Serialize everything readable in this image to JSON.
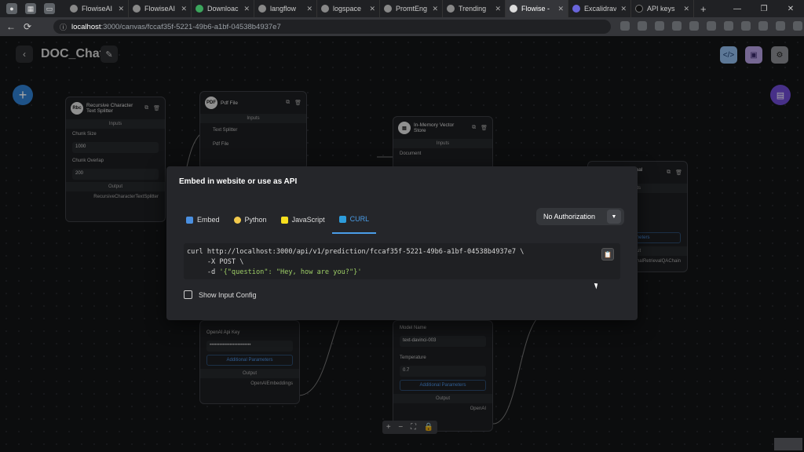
{
  "browser": {
    "tabs": [
      {
        "title": "FlowiseAI",
        "active": false
      },
      {
        "title": "FlowiseAI",
        "active": false
      },
      {
        "title": "Downloac",
        "active": false
      },
      {
        "title": "langflow",
        "active": false
      },
      {
        "title": "logspace",
        "active": false
      },
      {
        "title": "PromtEng",
        "active": false
      },
      {
        "title": "Trending",
        "active": false
      },
      {
        "title": "Flowise -",
        "active": true
      },
      {
        "title": "Excalidrav",
        "active": false
      },
      {
        "title": "API keys",
        "active": false
      }
    ],
    "url_host": "localhost",
    "url_path": ":3000/canvas/fccaf35f-5221-49b6-a1bf-04538b4937e7"
  },
  "canvas": {
    "title": "DOC_Chat",
    "nodes": {
      "splitter": {
        "title1": "Recursive Character",
        "title2": "Text Splitter",
        "inputs": "Inputs",
        "chunk_size_label": "Chunk Size",
        "chunk_size": "1000",
        "chunk_overlap_label": "Chunk Overlap",
        "chunk_overlap": "200",
        "output": "Output",
        "output_name": "RecursiveCharacterTextSplitter"
      },
      "pdf": {
        "title": "Pdf File",
        "inputs": "Inputs",
        "text_splitter": "Text Splitter",
        "pdf_file": "Pdf File"
      },
      "vector": {
        "title1": "In-Memory Vector",
        "title2": "Store",
        "inputs": "Inputs",
        "document": "Document"
      },
      "qachain": {
        "title1": "Conversational",
        "title2": "Chain",
        "inputs": "uts",
        "params": "Parameters",
        "output": "put",
        "output_name": "onalRetrievalQAChain"
      },
      "embeddings": {
        "api_key_label": "OpenAI Api Key",
        "api_key": "•••••••••••••••••••••••••",
        "additional": "Additional Parameters",
        "output": "Output",
        "output_name": "OpenAIEmbeddings"
      },
      "openai": {
        "model_label": "Model Name",
        "model": "text-davinci-003",
        "temp_label": "Temperature",
        "temp": "0.7",
        "additional": "Additional Parameters",
        "output": "Output",
        "output_name": "OpenAI"
      }
    }
  },
  "modal": {
    "title": "Embed in website or use as API",
    "tabs": [
      {
        "label": "Embed",
        "icon_color": "#4a8fe0"
      },
      {
        "label": "Python",
        "icon_color": "#f2c94c"
      },
      {
        "label": "JavaScript",
        "icon_color": "#f7df1e"
      },
      {
        "label": "CURL",
        "icon_color": "#2d9cdb"
      }
    ],
    "active_tab": "CURL",
    "auth": "No Authorization",
    "code": {
      "line1": "curl http://localhost:3000/api/v1/prediction/fccaf35f-5221-49b6-a1bf-04538b4937e7 \\",
      "line2": "     -X POST \\",
      "line3_prefix": "     -d ",
      "line3_string": "'{\"question\": \"Hey, how are you?\"}'"
    },
    "show_input_config": "Show Input Config"
  },
  "colors": {
    "accent": "#4a9de8",
    "add_button": "#2f7fcf",
    "chat_button": "#6d4bd1"
  }
}
